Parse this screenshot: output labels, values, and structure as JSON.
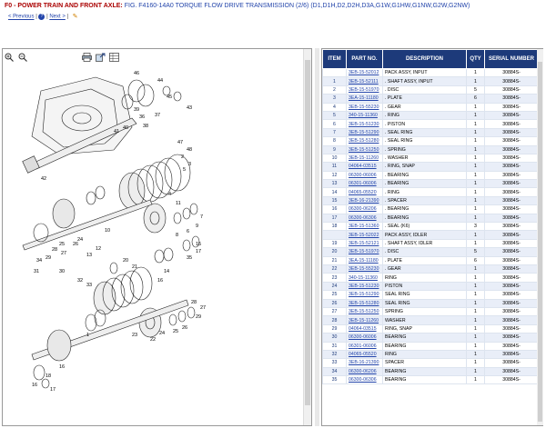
{
  "header": {
    "category": "F0 - POWER TRAIN AND FRONT AXLE:",
    "figure": "FIG. F4160-14A0 TORQUE FLOW DRIVE TRANSMISSION (2/6) (D1,D1H,D2,D2H,D3A,G1W,G1HW,G1NW,G2W,G2NW)"
  },
  "nav": {
    "previous": "< Previous",
    "sep1": "|",
    "sep2": "|",
    "next": "Next >",
    "sep3": "|"
  },
  "toolbar": {
    "zoom_in": "zoom-in-icon",
    "zoom_out": "zoom-out-icon",
    "print": "print-icon",
    "export": "export-icon",
    "grid": "grid-icon"
  },
  "drawing_callouts": [
    "46",
    "44",
    "45",
    "43",
    "37",
    "36",
    "39",
    "38",
    "40",
    "41",
    "42",
    "47",
    "48",
    "1",
    "2",
    "3",
    "4",
    "5",
    "6",
    "7",
    "8",
    "9",
    "10",
    "11",
    "12",
    "13",
    "14",
    "15",
    "16",
    "17",
    "18",
    "19",
    "20",
    "21",
    "22",
    "23",
    "24",
    "25",
    "26",
    "27",
    "28",
    "29",
    "30",
    "31",
    "32",
    "33",
    "34",
    "35",
    "36",
    "37",
    "38"
  ],
  "table": {
    "headers": {
      "item": "ITEM",
      "part": "PART NO.",
      "desc": "DESCRIPTION",
      "qty": "QTY",
      "serial": "SERIAL NUMBER"
    },
    "rows": [
      {
        "item": "",
        "part": "3EB-15-52012",
        "desc": "PACK ASSY, INPUT",
        "qty": "1",
        "ser": "30884S-"
      },
      {
        "item": "1",
        "part": "3EB-15-52111",
        "desc": ". SHAFT ASSY, INPUT",
        "qty": "1",
        "ser": "30884S-"
      },
      {
        "item": "2",
        "part": "3EB-15-51970",
        "desc": ". DISC",
        "qty": "5",
        "ser": "30884S-"
      },
      {
        "item": "3",
        "part": "3EA-15-11180",
        "desc": ". PLATE",
        "qty": "6",
        "ser": "30884S-"
      },
      {
        "item": "4",
        "part": "3EB-15-55230",
        "desc": ". GEAR",
        "qty": "1",
        "ser": "30884S-"
      },
      {
        "item": "5",
        "part": "340-15-11360",
        "desc": ". RING",
        "qty": "1",
        "ser": "30884S-"
      },
      {
        "item": "6",
        "part": "3EB-15-51230",
        "desc": ". PISTON",
        "qty": "1",
        "ser": "30884S-"
      },
      {
        "item": "7",
        "part": "3EB-15-51290",
        "desc": ". SEAL RING",
        "qty": "1",
        "ser": "30884S-"
      },
      {
        "item": "8",
        "part": "3EB-15-51280",
        "desc": ". SEAL RING",
        "qty": "1",
        "ser": "30884S-"
      },
      {
        "item": "9",
        "part": "3EB-15-51250",
        "desc": ". SPRING",
        "qty": "1",
        "ser": "30884S-"
      },
      {
        "item": "10",
        "part": "3EB-15-11260",
        "desc": ". WASHER",
        "qty": "1",
        "ser": "30884S-"
      },
      {
        "item": "11",
        "part": "04064-03515",
        "desc": ". RING, SNAP",
        "qty": "1",
        "ser": "30884S-"
      },
      {
        "item": "12",
        "part": "06300-06006",
        "desc": ". BEARING",
        "qty": "1",
        "ser": "30884S-"
      },
      {
        "item": "13",
        "part": "06301-06006",
        "desc": ". BEARING",
        "qty": "1",
        "ser": "30884S-"
      },
      {
        "item": "14",
        "part": "04065-05520",
        "desc": ". RING",
        "qty": "1",
        "ser": "30884S-"
      },
      {
        "item": "15",
        "part": "3EB-16-21390",
        "desc": ". SPACER",
        "qty": "1",
        "ser": "30884S-"
      },
      {
        "item": "16",
        "part": "06300-06206",
        "desc": ". BEARING",
        "qty": "1",
        "ser": "30884S-"
      },
      {
        "item": "17",
        "part": "06300-06306",
        "desc": ". BEARING",
        "qty": "1",
        "ser": "30884S-"
      },
      {
        "item": "18",
        "part": "3EB-15-51360",
        "desc": ". SEAL (K6)",
        "qty": "3",
        "ser": "30884S-"
      },
      {
        "item": "",
        "part": "3EB-15-52022",
        "desc": "PACK ASSY, IDLER",
        "qty": "1",
        "ser": "30884S-"
      },
      {
        "item": "19",
        "part": "3EB-15-52121",
        "desc": ". SHAFT ASSY, IDLER",
        "qty": "1",
        "ser": "30884S-"
      },
      {
        "item": "20",
        "part": "3EB-15-51970",
        "desc": ". DISC",
        "qty": "5",
        "ser": "30884S-"
      },
      {
        "item": "21",
        "part": "3EA-15-11180",
        "desc": ". PLATE",
        "qty": "6",
        "ser": "30884S-"
      },
      {
        "item": "22",
        "part": "3EB-15-55230",
        "desc": ". GEAR",
        "qty": "1",
        "ser": "30884S-"
      },
      {
        "item": "23",
        "part": "340-15-11360",
        "desc": "RING",
        "qty": "1",
        "ser": "30884S-"
      },
      {
        "item": "24",
        "part": "3EB-15-51230",
        "desc": "PISTON",
        "qty": "1",
        "ser": "30884S-"
      },
      {
        "item": "25",
        "part": "3EB-15-51290",
        "desc": "SEAL RING",
        "qty": "1",
        "ser": "30884S-"
      },
      {
        "item": "26",
        "part": "3EB-15-51280",
        "desc": "SEAL RING",
        "qty": "1",
        "ser": "30884S-"
      },
      {
        "item": "27",
        "part": "3EB-15-51250",
        "desc": "SPRING",
        "qty": "1",
        "ser": "30884S-"
      },
      {
        "item": "28",
        "part": "3EB-15-11260",
        "desc": "WASHER",
        "qty": "1",
        "ser": "30884S-"
      },
      {
        "item": "29",
        "part": "04064-03515",
        "desc": "RING, SNAP",
        "qty": "1",
        "ser": "30884S-"
      },
      {
        "item": "30",
        "part": "06300-06006",
        "desc": "BEARING",
        "qty": "1",
        "ser": "30884S-"
      },
      {
        "item": "31",
        "part": "06301-06006",
        "desc": "BEARING",
        "qty": "1",
        "ser": "30884S-"
      },
      {
        "item": "32",
        "part": "04065-05520",
        "desc": "RING",
        "qty": "1",
        "ser": "30884S-"
      },
      {
        "item": "33",
        "part": "3EB-16-21390",
        "desc": "SPACER",
        "qty": "1",
        "ser": "30884S-"
      },
      {
        "item": "34",
        "part": "06300-06206",
        "desc": "BEARING",
        "qty": "1",
        "ser": "30884S-"
      },
      {
        "item": "35",
        "part": "06300-06306",
        "desc": "BEARING",
        "qty": "1",
        "ser": "30884S-"
      }
    ]
  }
}
